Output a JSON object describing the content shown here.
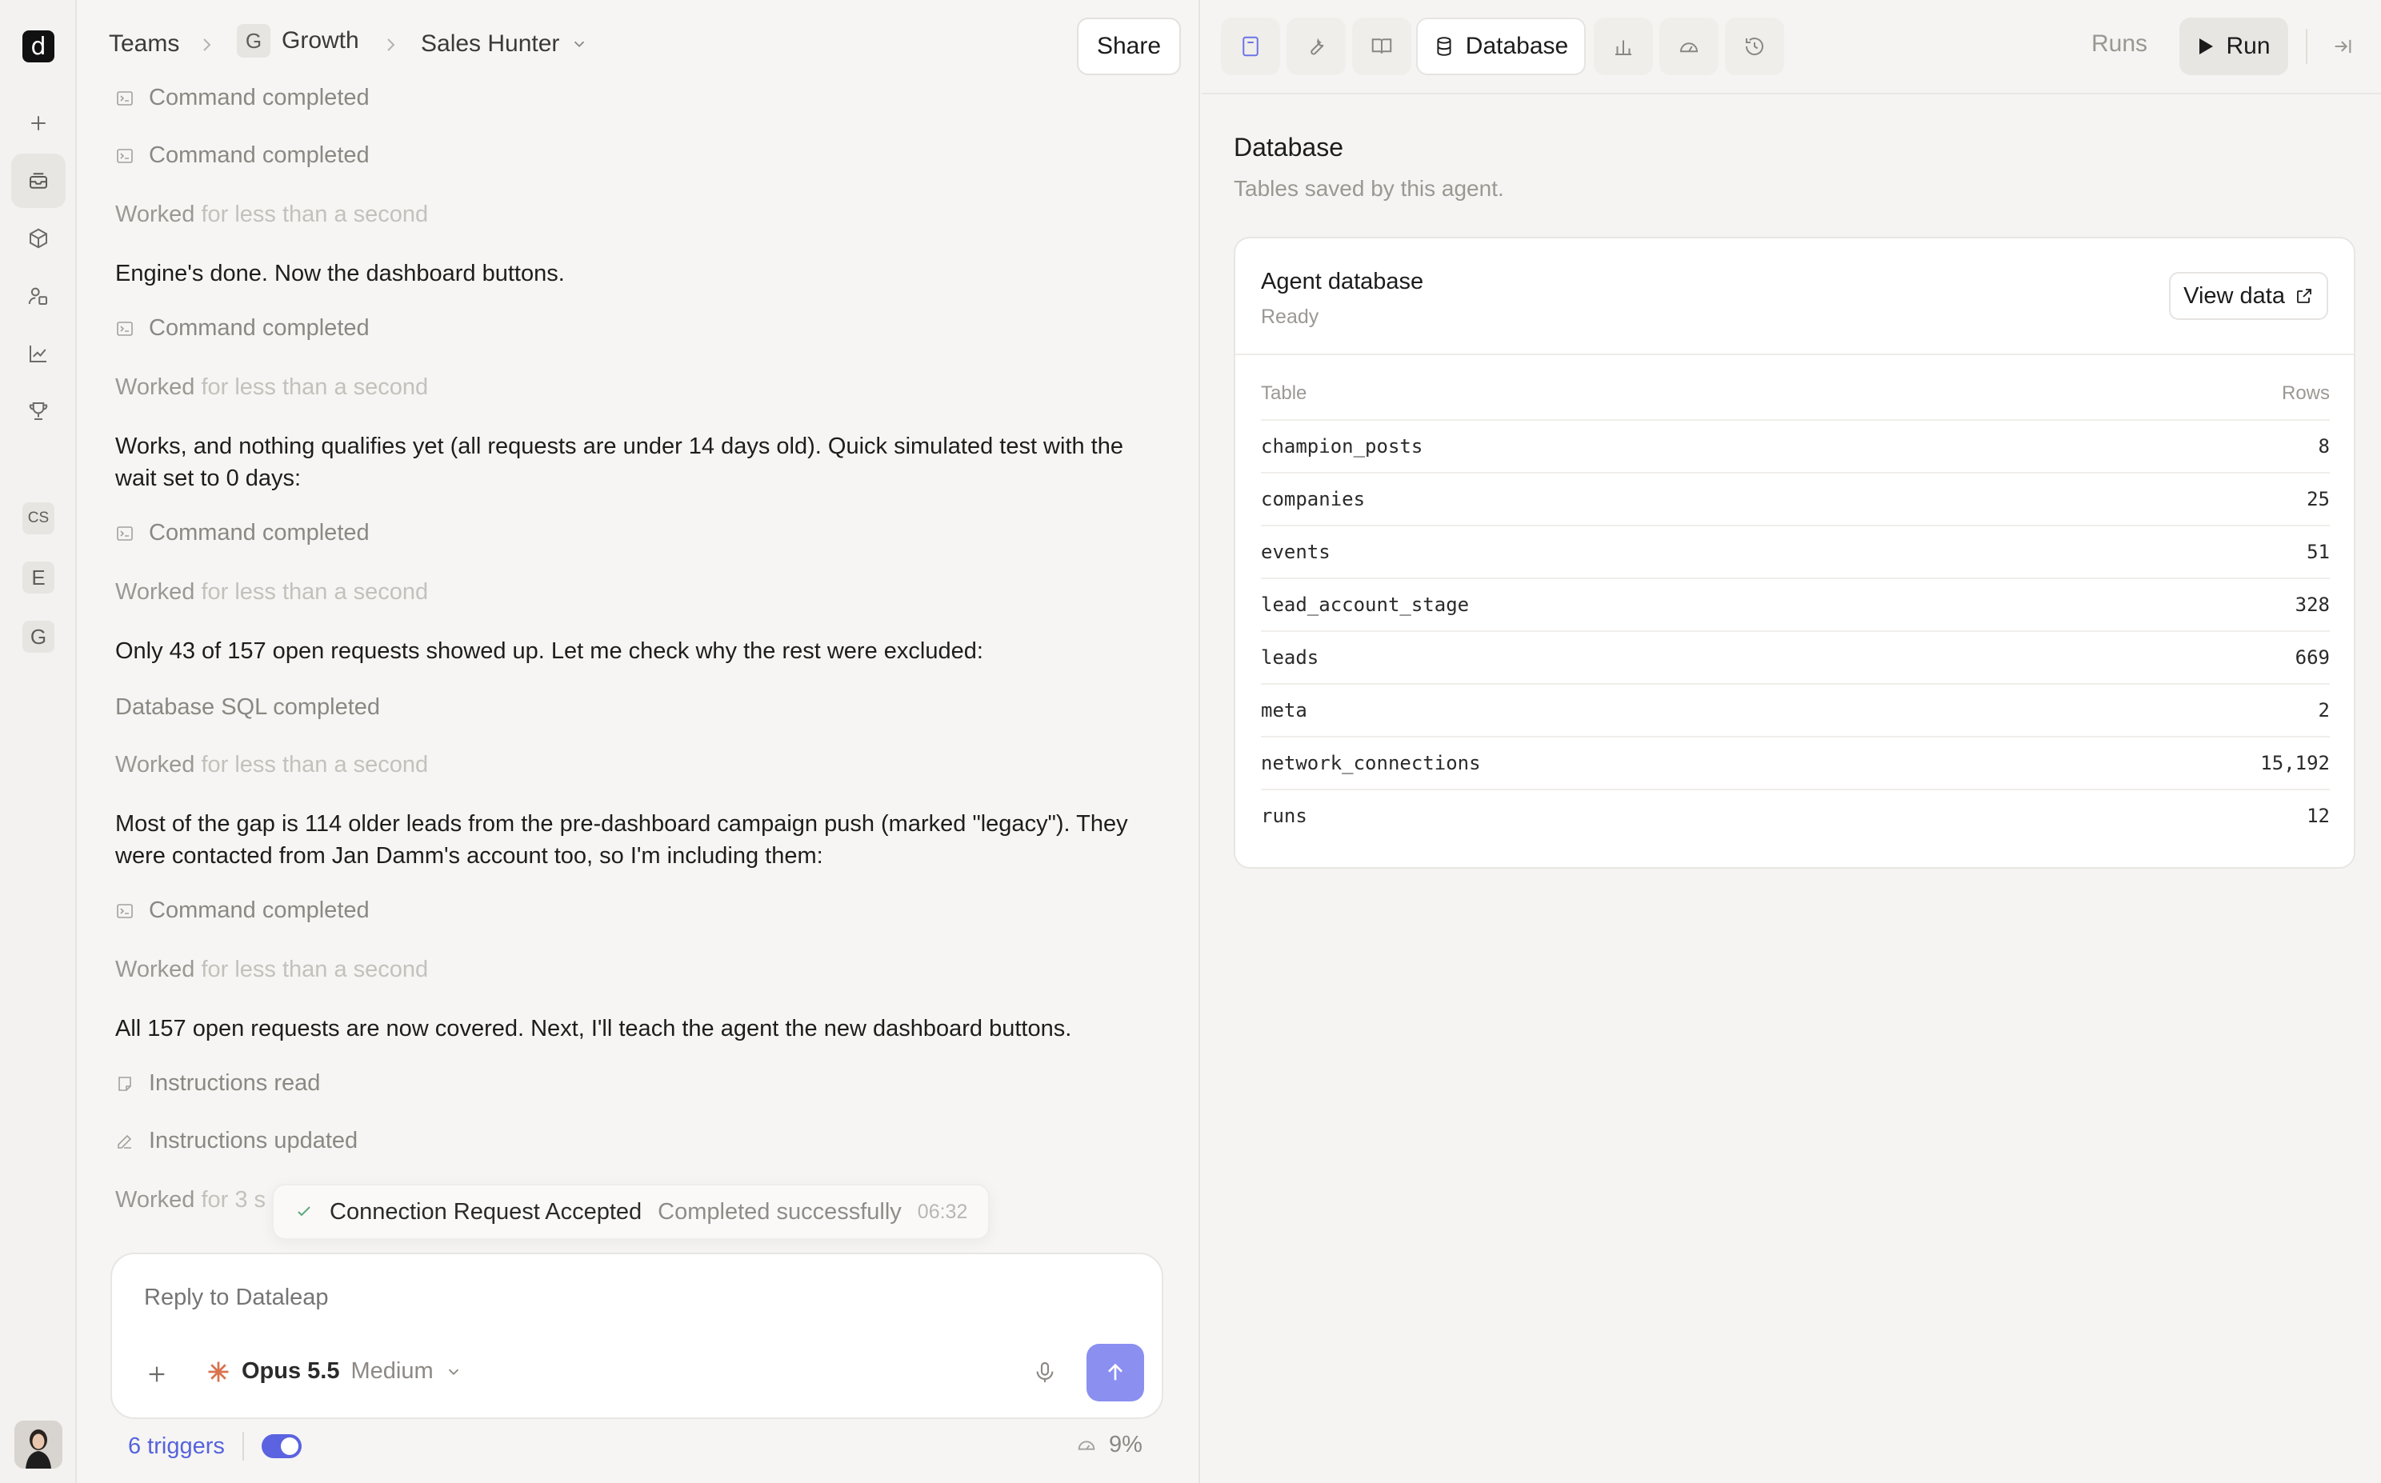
{
  "rail": {
    "logo": "d",
    "workspaces": [
      "CS",
      "E",
      "G"
    ]
  },
  "breadcrumb": {
    "team": "Teams",
    "group_initial": "G",
    "group": "Growth",
    "agent": "Sales Hunter"
  },
  "header": {
    "share_label": "Share"
  },
  "messages": {
    "s1": "Command completed",
    "s2": "Command completed",
    "w1_a": "Worked",
    "w1_b": "for less than a second",
    "t1": "Engine's done. Now the dashboard buttons.",
    "s3": "Command completed",
    "w2_a": "Worked",
    "w2_b": "for less than a second",
    "t2": "Works, and nothing qualifies yet (all requests are under 14 days old). Quick simulated test with the wait set to 0 days:",
    "s4": "Command completed",
    "w3_a": "Worked",
    "w3_b": "for less than a second",
    "t3": "Only 43 of 157 open requests showed up. Let me check why the rest were excluded:",
    "s5": "Database SQL completed",
    "w4_a": "Worked",
    "w4_b": "for less than a second",
    "t4": "Most of the gap is 114 older leads from the pre-dashboard campaign push (marked \"legacy\"). They were contacted from Jan Damm's account too, so I'm including them:",
    "s6": "Command completed",
    "w5_a": "Worked",
    "w5_b": "for less than a second",
    "t5": "All 157 open requests are now covered. Next, I'll teach the agent the new dashboard buttons.",
    "s7": "Instructions read",
    "s8": "Instructions updated",
    "w6_a": "Worked",
    "w6_b": "for 3 s"
  },
  "toast": {
    "title": "Connection Request Accepted",
    "status": "Completed successfully",
    "time": "06:32"
  },
  "composer": {
    "placeholder": "Reply to Dataleap",
    "model": "Opus 5.5",
    "effort": "Medium"
  },
  "footer": {
    "triggers": "6 triggers",
    "usage": "9%"
  },
  "panel_tabs": {
    "active": "Database",
    "runs": "Runs",
    "run": "Run"
  },
  "database": {
    "title": "Database",
    "subtitle": "Tables saved by this agent.",
    "card_title": "Agent database",
    "card_status": "Ready",
    "view_data": "View data",
    "col_table": "Table",
    "col_rows": "Rows",
    "tables": [
      {
        "name": "champion_posts",
        "rows": "8"
      },
      {
        "name": "companies",
        "rows": "25"
      },
      {
        "name": "events",
        "rows": "51"
      },
      {
        "name": "lead_account_stage",
        "rows": "328"
      },
      {
        "name": "leads",
        "rows": "669"
      },
      {
        "name": "meta",
        "rows": "2"
      },
      {
        "name": "network_connections",
        "rows": "15,192"
      },
      {
        "name": "runs",
        "rows": "12"
      }
    ]
  },
  "colors": {
    "accent": "#5b63e0",
    "send_button": "#8a8ff0",
    "background": "#f6f5f3"
  }
}
